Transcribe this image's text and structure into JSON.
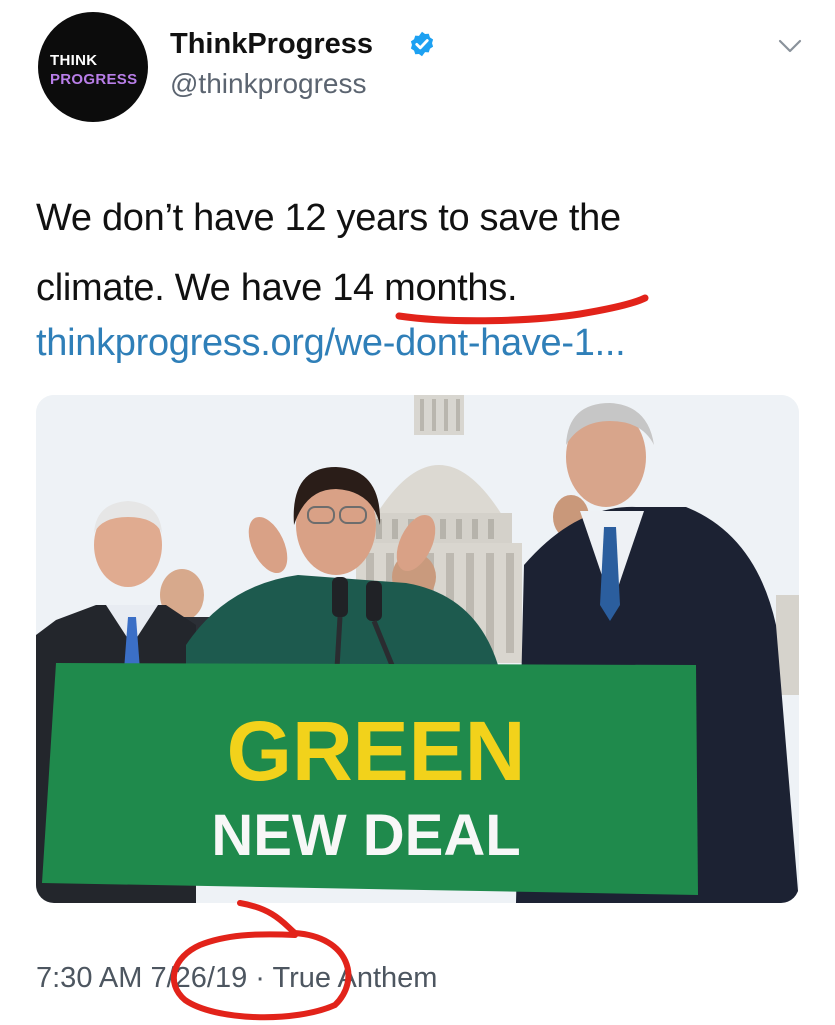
{
  "account": {
    "avatar_logo_line1": "THINK",
    "avatar_logo_line2": "PROGRESS",
    "display_name": "ThinkProgress",
    "handle": "@thinkprogress",
    "verified": true
  },
  "tweet": {
    "text_line1": "We don’t have 12 years to save the",
    "text_line2": "climate. We have 14 months.",
    "link": "thinkprogress.org/we-dont-have-1..."
  },
  "photo": {
    "sign_line1": "GREEN",
    "sign_line2": "NEW DEAL"
  },
  "footer": {
    "time": "7:30 AM",
    "date": "7/26/19",
    "separator": "·",
    "source": "True Anthem"
  },
  "icons": {
    "verified": "verified-badge-icon",
    "menu": "chevron-down-icon"
  },
  "colors": {
    "link": "#2f7fb8",
    "verified": "#1da1f2",
    "annotation": "#e2231a",
    "sign_green": "#1f8a4c",
    "sign_yellow": "#f2d21b"
  }
}
